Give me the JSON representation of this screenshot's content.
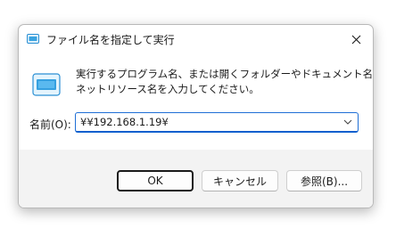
{
  "window": {
    "title": "ファイル名を指定して実行",
    "close_icon": "close-icon"
  },
  "description": {
    "line1": "実行するプログラム名、または開くフォルダーやドキュメント名、インター",
    "line2": "ネットリソース名を入力してください。"
  },
  "name_field": {
    "label": "名前(O):",
    "value": "¥¥192.168.1.19¥"
  },
  "buttons": {
    "ok": "OK",
    "cancel": "キャンセル",
    "browse": "参照(B)..."
  },
  "colors": {
    "accent": "#0a5fce",
    "footer_bg": "#f3f3f3"
  }
}
